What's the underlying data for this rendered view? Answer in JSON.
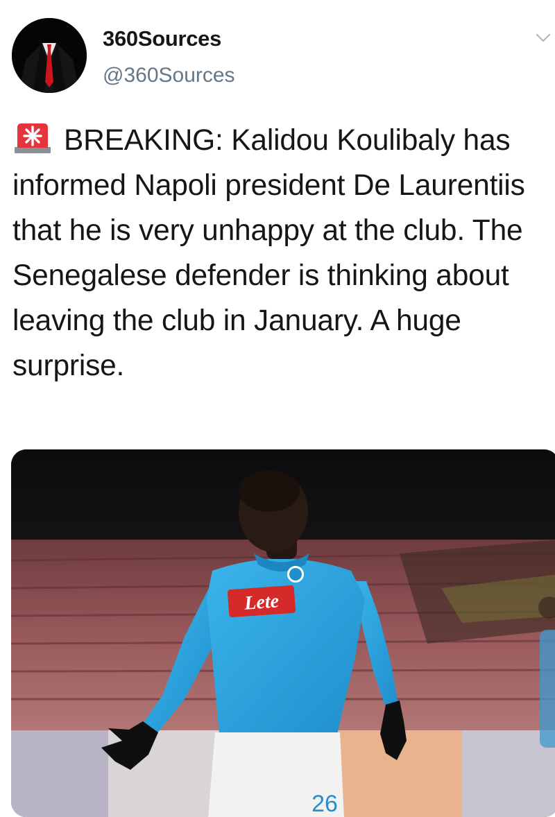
{
  "tweet": {
    "author": {
      "display_name": "360Sources",
      "handle": "@360Sources",
      "avatar_icon": "suit-silhouette-avatar"
    },
    "menu_icon": "chevron-down-icon",
    "emoji_icon": "siren-icon",
    "text": "BREAKING: Kalidou Koulibaly has informed Napoli president De Laurentiis that he is very unhappy at the club. The Senegalese defender is thinking about leaving the club in January. A huge surprise.",
    "media": {
      "kind": "photo",
      "jersey_sponsor": "Lete",
      "jersey_number": "26"
    }
  },
  "colors": {
    "text": "#14171a",
    "secondary_text": "#657786",
    "jersey_blue": "#2ba6df",
    "sponsor_red": "#d42a2a"
  }
}
